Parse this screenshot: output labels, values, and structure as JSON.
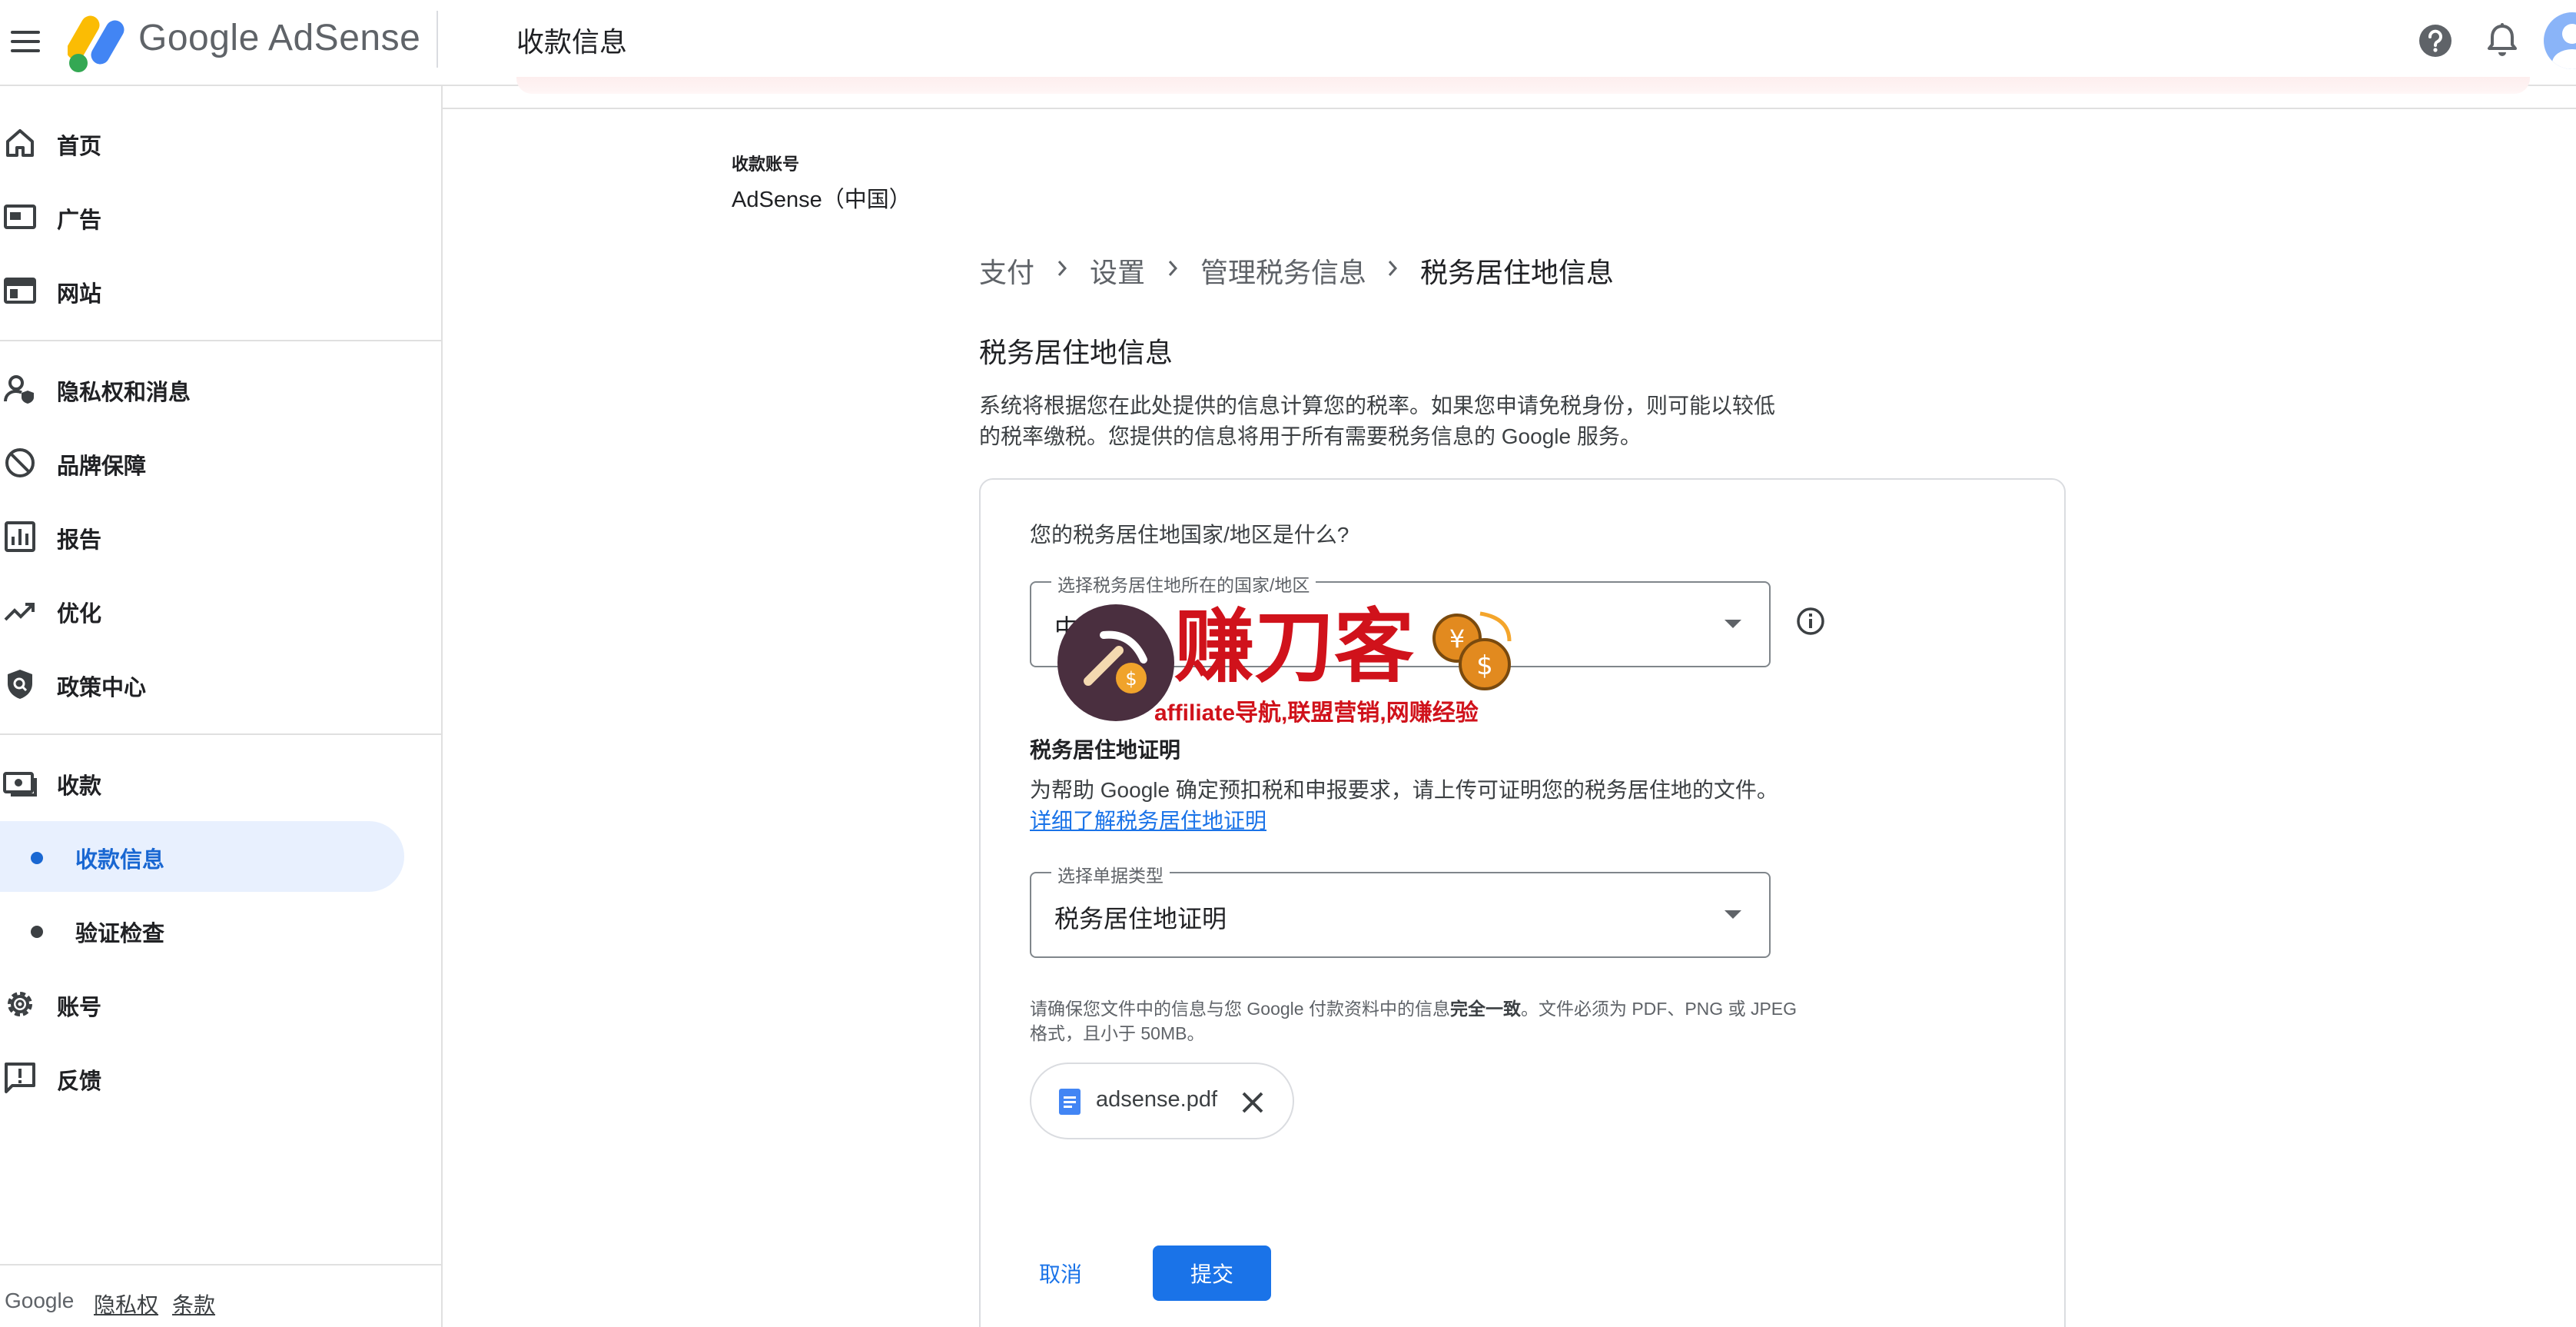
{
  "app": {
    "brand": "Google AdSense",
    "page_title": "收款信息"
  },
  "sidebar": {
    "items": [
      {
        "label": "首页",
        "icon": "home-icon"
      },
      {
        "label": "广告",
        "icon": "ads-icon"
      },
      {
        "label": "网站",
        "icon": "sites-icon"
      },
      {
        "label": "隐私权和消息",
        "icon": "privacy-icon"
      },
      {
        "label": "品牌保障",
        "icon": "block-icon"
      },
      {
        "label": "报告",
        "icon": "report-icon"
      },
      {
        "label": "优化",
        "icon": "trend-icon"
      },
      {
        "label": "政策中心",
        "icon": "policy-icon"
      },
      {
        "label": "收款",
        "icon": "payments-icon"
      },
      {
        "label": "收款信息",
        "icon": "dot",
        "active": true
      },
      {
        "label": "验证检查",
        "icon": "dot"
      },
      {
        "label": "账号",
        "icon": "gear-icon"
      },
      {
        "label": "反馈",
        "icon": "feedback-icon"
      }
    ],
    "footer": {
      "google": "Google",
      "privacy": "隐私权",
      "terms": "条款"
    }
  },
  "account": {
    "label": "收款账号",
    "value": "AdSense（中国）"
  },
  "breadcrumb": [
    "支付",
    "设置",
    "管理税务信息",
    "税务居住地信息"
  ],
  "section": {
    "title": "税务居住地信息",
    "description": "系统将根据您在此处提供的信息计算您的税率。如果您申请免税身份，则可能以较低的税率缴税。您提供的信息将用于所有需要税务信息的 Google 服务。"
  },
  "form": {
    "question": "您的税务居住地国家/地区是什么?",
    "country_select": {
      "legend": "选择税务居住地所在的国家/地区",
      "value": "中国"
    },
    "proof": {
      "title": "税务居住地证明",
      "description": "为帮助 Google 确定预扣税和申报要求，请上传可证明您的税务居住地的文件。",
      "link": "详细了解税务居住地证明"
    },
    "doc_select": {
      "legend": "选择单据类型",
      "value": "税务居住地证明"
    },
    "note_pre": "请确保您文件中的信息与您 Google 付款资料中的信息",
    "note_bold": "完全一致",
    "note_post": "。文件必须为 PDF、PNG 或 JPEG 格式，且小于 50MB。",
    "file": {
      "name": "adsense.pdf"
    },
    "cancel_label": "取消",
    "submit_label": "提交"
  },
  "watermark": {
    "title": "赚刀客",
    "subtitle": "affiliate导航,联盟营销,网赚经验"
  },
  "colors": {
    "accent": "#1a73e8",
    "active_bg": "#e8f0fe",
    "active_text": "#1967d2",
    "watermark": "#d0121b"
  }
}
